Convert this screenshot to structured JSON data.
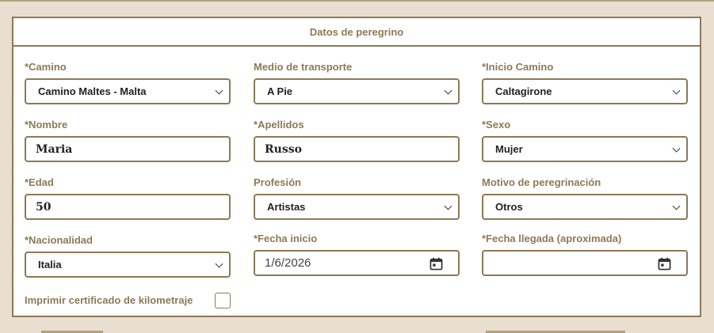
{
  "form": {
    "title": "Datos de peregrino",
    "fields": {
      "camino": {
        "label": "*Camino",
        "value": "Camino Maltes - Malta"
      },
      "transporte": {
        "label": "Medio de transporte",
        "value": "A Pie"
      },
      "inicio": {
        "label": "*Inicio Camino",
        "value": "Caltagirone"
      },
      "nombre": {
        "label": "*Nombre",
        "value": "Maria"
      },
      "apellidos": {
        "label": "*Apellidos",
        "value": "Russo"
      },
      "sexo": {
        "label": "*Sexo",
        "value": "Mujer"
      },
      "edad": {
        "label": "*Edad",
        "value": "50"
      },
      "profesion": {
        "label": "Profesión",
        "value": "Artistas"
      },
      "motivo": {
        "label": "Motivo de peregrinación",
        "value": "Otros"
      },
      "nacionalidad": {
        "label": "*Nacionalidad",
        "value": "Italia"
      },
      "fecha_inicio": {
        "label": "*Fecha inicio",
        "value": "1/6/2026"
      },
      "fecha_llegada": {
        "label": "*Fecha llegada (aproximada)",
        "value": ""
      }
    },
    "certificado": {
      "label": "Imprimir certificado de kilometraje",
      "checked": false
    }
  },
  "icons": {
    "select": "chevron-down-icon",
    "date": "calendar-icon"
  },
  "colors": {
    "accent": "#8c7a57",
    "background": "#e8dfd1",
    "panel": "#ffffff"
  }
}
